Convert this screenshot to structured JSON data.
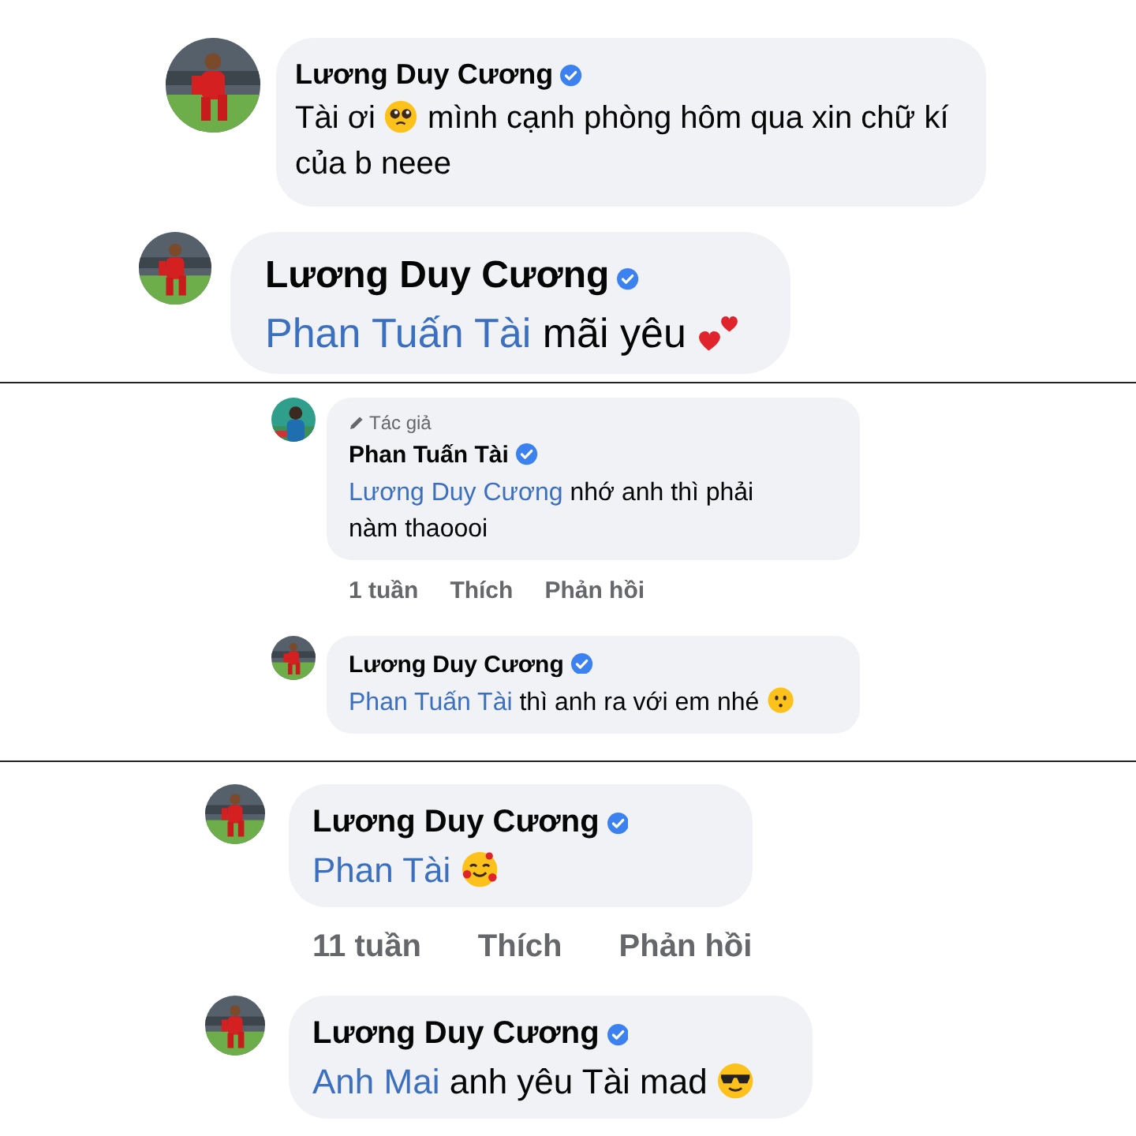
{
  "sections": [
    {
      "comments": [
        {
          "author": "Lương Duy Cương",
          "verified": true,
          "text": [
            {
              "kind": "text",
              "text": "Tài ơi"
            },
            {
              "kind": "pleading_emoji"
            },
            {
              "kind": "text",
              "text": "mình cạnh phòng hôm qua xin chữ kí của b neee"
            }
          ]
        },
        {
          "author": "Lương Duy Cương",
          "verified": true,
          "text": [
            {
              "kind": "mention",
              "text": "Phan Tuấn Tài"
            },
            {
              "kind": "text",
              "text": "mãi yêu"
            },
            {
              "kind": "two_hearts_emoji"
            }
          ]
        }
      ]
    },
    {
      "comments": [
        {
          "badge": "Tác giả",
          "author": "Phan Tuấn Tài",
          "verified": true,
          "text": [
            {
              "kind": "mention",
              "text": "Lương Duy Cương"
            },
            {
              "kind": "text",
              "text": "nhớ anh thì phải nàm thaoooi"
            }
          ],
          "actions": {
            "time": "1 tuần",
            "like": "Thích",
            "reply": "Phản hồi"
          }
        },
        {
          "author": "Lương Duy Cương",
          "verified": true,
          "text": [
            {
              "kind": "mention",
              "text": "Phan Tuấn Tài"
            },
            {
              "kind": "text",
              "text": "thì anh ra với em nhé"
            },
            {
              "kind": "hushed_emoji"
            }
          ]
        }
      ]
    },
    {
      "comments": [
        {
          "author": "Lương Duy Cương",
          "verified": true,
          "text": [
            {
              "kind": "mention",
              "text": "Phan Tài"
            },
            {
              "kind": "smiling_hearts_emoji"
            }
          ],
          "actions": {
            "time": "11 tuần",
            "like": "Thích",
            "reply": "Phản hồi"
          }
        },
        {
          "author": "Lương Duy Cương",
          "verified": true,
          "text": [
            {
              "kind": "mention",
              "text": "Anh Mai"
            },
            {
              "kind": "text",
              "text": "anh yêu Tài mad"
            },
            {
              "kind": "sunglasses_emoji"
            }
          ]
        }
      ]
    }
  ]
}
